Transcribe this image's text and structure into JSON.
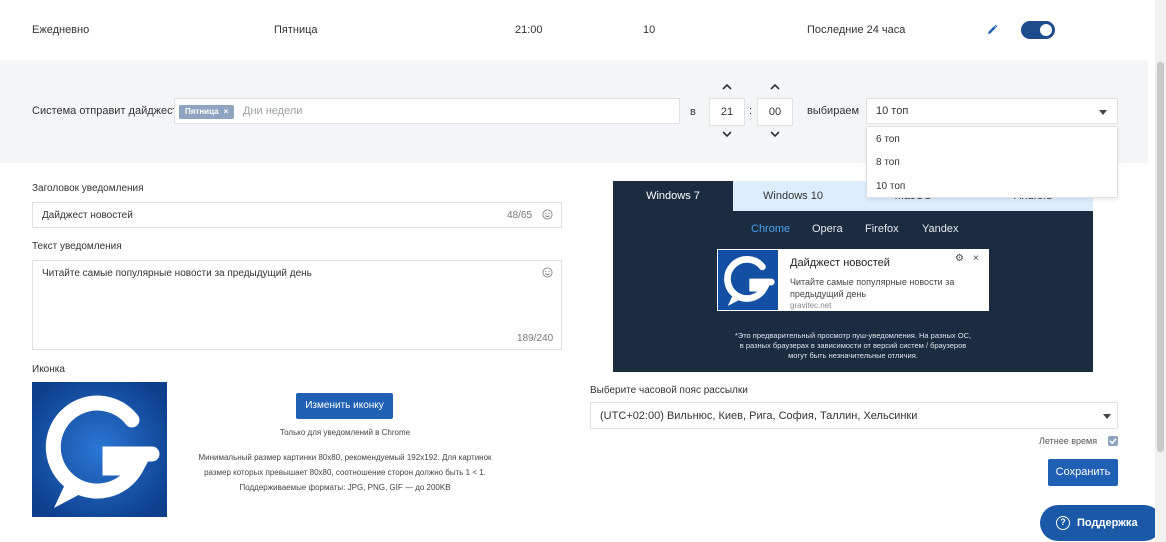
{
  "schedule_row": {
    "frequency": "Ежедневно",
    "day": "Пятница",
    "time": "21:00",
    "count": "10",
    "period": "Последние 24 часа",
    "enabled": true
  },
  "digest": {
    "label": "Система отправит дайджест",
    "selected_day_chip": "Пятница",
    "chip_remove": "×",
    "days_placeholder": "Дни недели",
    "at_label": "в",
    "hour": "21",
    "time_separator": ":",
    "minute": "00",
    "pick_label": "выбираем",
    "selected_top": "10 топ",
    "top_options": [
      "6 топ",
      "8 топ",
      "10 топ"
    ]
  },
  "form": {
    "title_label": "Заголовок уведомления",
    "title_value": "Дайджест новостей",
    "title_counter": "48/65",
    "text_label": "Текст уведомления",
    "text_value": "Читайте самые популярные новости за предыдущий день",
    "text_counter": "189/240",
    "icon_label": "Иконка",
    "change_icon_button": "Изменить иконку",
    "chrome_only_note": "Только для уведомлений в Chrome",
    "size_note_1": "Минимальный размер картинки 80x80, рекомендуемый 192x192. Для картинок",
    "size_note_2": "размер которых превышает 80x80, соотношение сторон должно быть 1 < 1.",
    "formats_note": "Поддерживаемые форматы: JPG, PNG, GIF — до 200KB"
  },
  "preview": {
    "os_tabs": [
      "Windows 7",
      "Windows 10",
      "MacOS",
      "Android"
    ],
    "active_os": "Windows 7",
    "browsers": [
      "Chrome",
      "Opera",
      "Firefox",
      "Yandex"
    ],
    "active_browser": "Chrome",
    "notification": {
      "title": "Дайджест новостей",
      "body": "Читайте самые популярные новости за предыдущий день",
      "url": "gravitec.net",
      "settings_glyph": "⚙",
      "close_glyph": "×"
    },
    "disclaimer_1": "*Это предварительный просмотр пуш-уведомления. На разных ОС,",
    "disclaimer_2": "в разных браузерах в зависимости от версий систем / браузеров",
    "disclaimer_3": "могут быть незначительные отличия."
  },
  "timezone": {
    "label": "Выберите часовой пояс рассылки",
    "value": "(UTC+02:00) Вильнюс, Киев, Рига, София, Таллин, Хельсинки",
    "dst_label": "Летнее время",
    "dst_checked": true
  },
  "actions": {
    "save_button": "Сохранить",
    "support_icon": "?",
    "support_button": "Поддержка"
  },
  "colors": {
    "accent": "#1f5fb4",
    "toggle_on": "#1e4b8c",
    "chip": "#8fa4c1",
    "preview_bg": "#1b2b40",
    "active_browser": "#4aa3f0",
    "logo_bg": "#1350a4"
  },
  "icons": [
    "pencil-icon",
    "chevron-up-icon",
    "chevron-down-icon",
    "caret-down-icon",
    "smiley-icon",
    "gear-icon",
    "close-icon",
    "question-icon",
    "logo-g-icon"
  ]
}
